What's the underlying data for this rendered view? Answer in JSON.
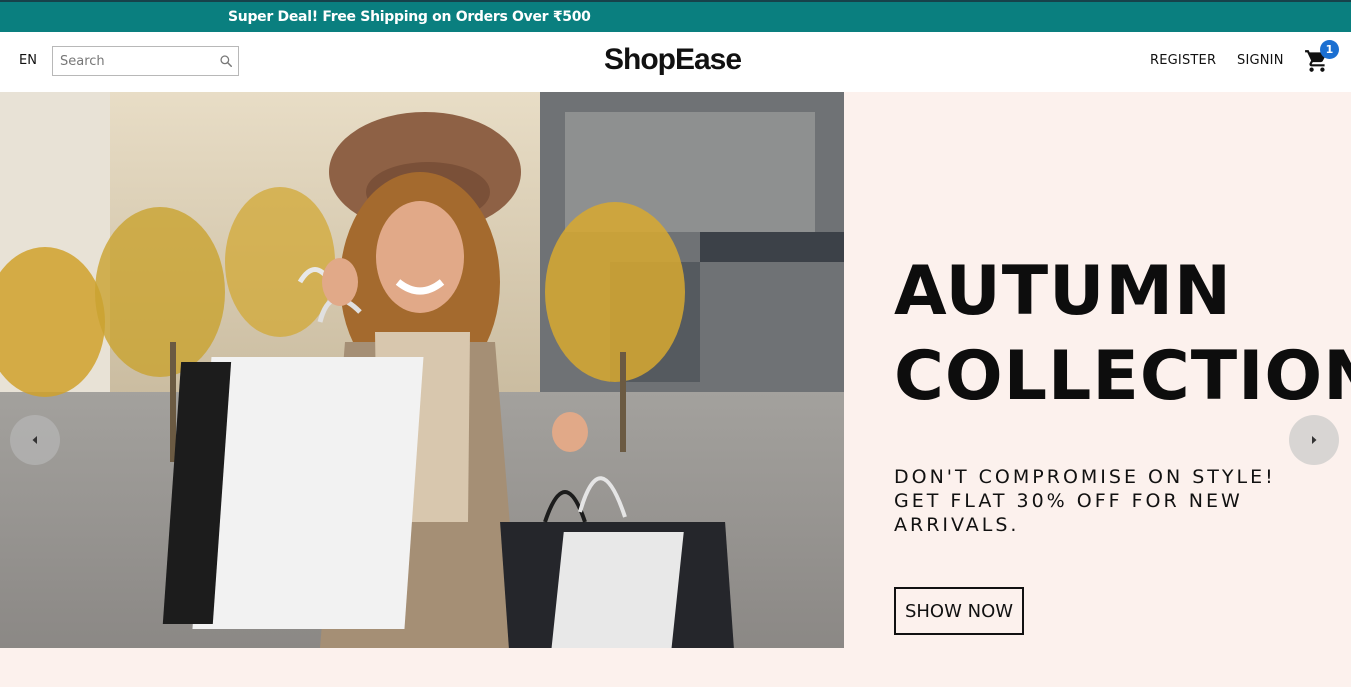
{
  "announcement": {
    "text": "Super Deal! Free Shipping on Orders Over ₹500"
  },
  "header": {
    "language": "EN",
    "search_placeholder": "Search",
    "logo": "ShopEase",
    "register_label": "REGISTER",
    "signin_label": "SIGNIN",
    "cart_count": "1"
  },
  "hero": {
    "title_line_1": "AUTUMN",
    "title_line_2": "COLLECTION",
    "subtitle": "DON'T COMPROMISE ON STYLE! GET FLAT 30% OFF FOR NEW ARRIVALS.",
    "cta_label": "SHOW NOW",
    "background_color": "#fcf1ed"
  },
  "colors": {
    "announcement_bg": "#0a7f7f",
    "cart_badge": "#1b6fd1"
  },
  "icons": {
    "search": "search-icon",
    "cart": "cart-icon",
    "prev": "chevron-left-icon",
    "next": "chevron-right-icon"
  }
}
